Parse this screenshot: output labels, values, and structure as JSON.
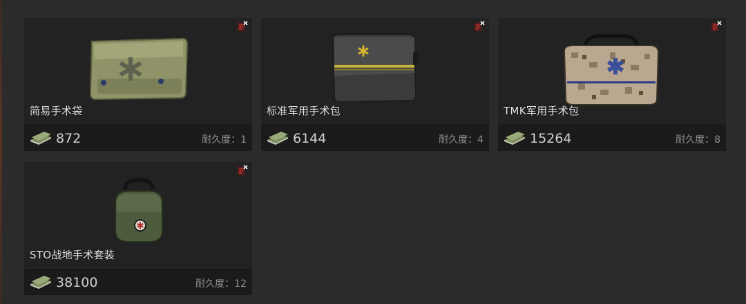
{
  "items": [
    {
      "name": "简易手术袋",
      "price": "872",
      "durability": "耐久度：1",
      "icon": "medical-pouch-olive"
    },
    {
      "name": "标准军用手术包",
      "price": "6144",
      "durability": "耐久度：4",
      "icon": "medical-bag-black"
    },
    {
      "name": "TMK军用手术包",
      "price": "15264",
      "durability": "耐久度：8",
      "icon": "medical-case-digital-camo"
    },
    {
      "name": "STO战地手术套装",
      "price": "38100",
      "durability": "耐久度：12",
      "icon": "medical-kit-green"
    }
  ],
  "icons": {
    "currency": "cash-stack-icon",
    "badge": "no-insurance-flag-icon"
  },
  "colors": {
    "panel": "#222222",
    "footer": "#1b1b1b",
    "text": "#e6e6e6",
    "muted": "#8d8d8d"
  }
}
